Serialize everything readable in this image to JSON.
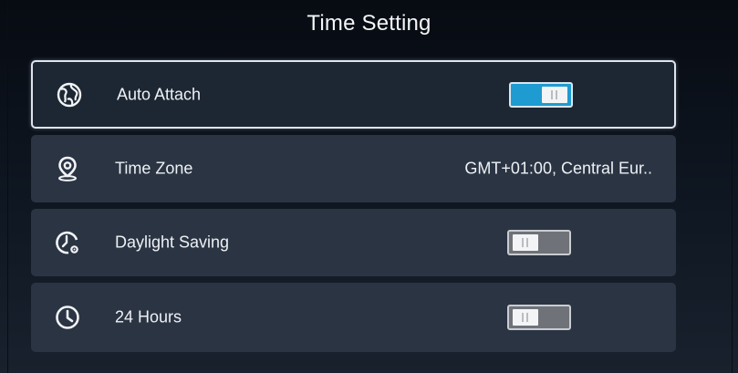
{
  "screen": {
    "title": "Time Setting"
  },
  "settings": [
    {
      "label": "Auto Attach",
      "icon": "globe-icon",
      "control": "toggle",
      "state": "on",
      "selected": true
    },
    {
      "label": "Time Zone",
      "icon": "location-pin-icon",
      "control": "value",
      "value": "GMT+01:00, Central Eur.."
    },
    {
      "label": "Daylight Saving",
      "icon": "clock-gear-icon",
      "control": "toggle",
      "state": "off"
    },
    {
      "label": "24 Hours",
      "icon": "clock-icon",
      "control": "toggle",
      "state": "off"
    }
  ],
  "colors": {
    "toggle_on": "#1e9bd1",
    "toggle_off": "#6f7379",
    "row_background": "#2a3443",
    "selected_border": "#dfe5ee"
  }
}
